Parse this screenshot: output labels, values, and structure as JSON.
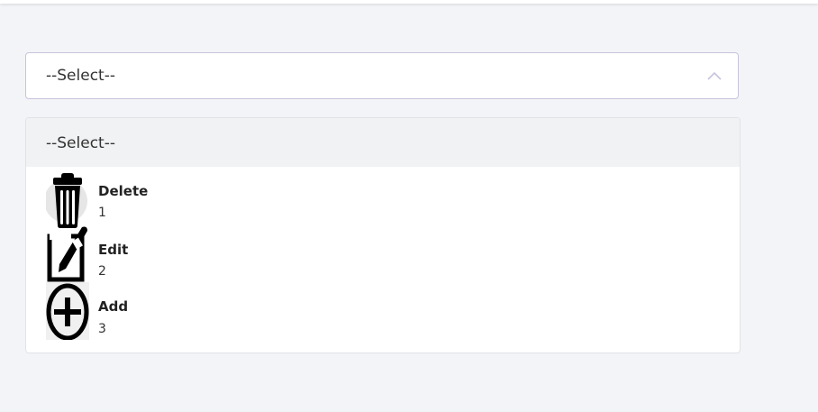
{
  "select": {
    "value": "--Select--",
    "state": "open",
    "chevron_icon": "chevron-up-icon"
  },
  "dropdown": {
    "placeholder_option": "--Select--",
    "options": [
      {
        "label": "Delete",
        "value": "1",
        "icon": "trash-icon"
      },
      {
        "label": "Edit",
        "value": "2",
        "icon": "edit-icon"
      },
      {
        "label": "Add",
        "value": "3",
        "icon": "add-circle-icon"
      }
    ]
  },
  "colors": {
    "page_background": "#f2f4f7",
    "select_border": "#c9c3dc",
    "dropdown_header_bg": "#f1f2f3",
    "icon_color": "#000000"
  }
}
